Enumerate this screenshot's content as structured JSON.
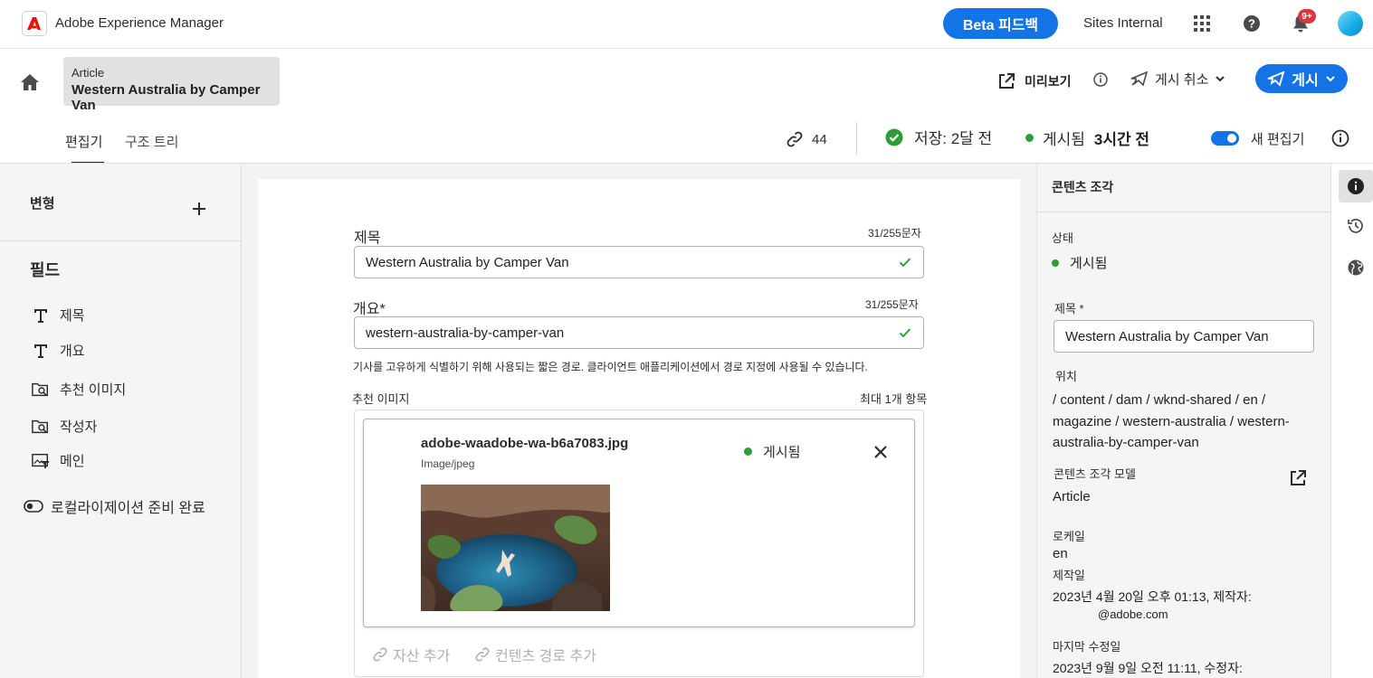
{
  "app": {
    "title": "Adobe Experience Manager"
  },
  "topbar": {
    "beta_label": "Beta 피드백",
    "org": "Sites Internal",
    "notification_badge": "9+",
    "accent_color": "#1473e6"
  },
  "header": {
    "breadcrumb_type": "Article",
    "breadcrumb_title": "Western Australia by Camper Van",
    "preview_label": "미리보기",
    "unpublish_label": "게시 취소",
    "publish_label": "게시"
  },
  "tabs": [
    {
      "label": "편집기",
      "active": true
    },
    {
      "label": "구조 트리",
      "active": false
    }
  ],
  "status": {
    "links_count": "44",
    "saved_text": "저장: 2달 전",
    "published_prefix": "게시됨",
    "published_time": "3시간 전",
    "new_editor_label": "새 편집기",
    "new_editor_on": true
  },
  "sidebar": {
    "variants_label": "변형",
    "fields_label": "필드",
    "fields": [
      {
        "label": "제목",
        "icon": "text-icon"
      },
      {
        "label": "개요",
        "icon": "text-icon"
      },
      {
        "label": "추천 이미지",
        "icon": "image-search-icon"
      },
      {
        "label": "작성자",
        "icon": "image-search-icon"
      },
      {
        "label": "메인",
        "icon": "rich-text-icon"
      }
    ],
    "localization_label": "로컬라이제이션 준비 완료"
  },
  "form": {
    "title": {
      "label": "제목",
      "count": "31/255문자",
      "value": "Western Australia by Camper Van"
    },
    "slug": {
      "label": "개요*",
      "count": "31/255문자",
      "value": "western-australia-by-camper-van",
      "helper": "기사를 고유하게 식별하기 위해 사용되는 짧은 경로. 클라이언트 애플리케이션에서 경로 지정에 사용될 수 있습니다."
    },
    "featured_image": {
      "label": "추천 이미지",
      "max": "최대 1개 항목",
      "asset_name": "adobe-waadobe-wa-b6a7083.jpg",
      "asset_type": "Image/jpeg",
      "asset_status": "게시됨",
      "add_asset": "자산 추가",
      "add_path": "컨텐츠 경로 추가"
    }
  },
  "properties": {
    "title": "콘텐츠 조각",
    "status_label": "상태",
    "status_value": "게시됨",
    "title_label": "제목 *",
    "title_value": "Western Australia by Camper Van",
    "location_label": "위치",
    "location_value": "/ content / dam / wknd-shared / en / magazine / western-australia / western-australia-by-camper-van",
    "model_label": "콘텐츠 조각 모델",
    "model_value": "Article",
    "locale_label": "로케일",
    "locale_value": "en",
    "created_label": "제작일",
    "created_value": "2023년 4월 20일 오후 01:13, 제작자:",
    "created_by": "@adobe.com",
    "modified_label": "마지막 수정일",
    "modified_value": "2023년 9월 9일 오전 11:11, 수정자:"
  },
  "colors": {
    "success": "#2d9d3a",
    "badge": "#d7373f"
  }
}
